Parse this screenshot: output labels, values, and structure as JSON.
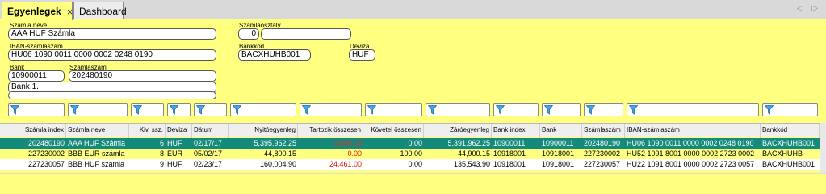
{
  "tabs": [
    {
      "label": "Egyenlegek",
      "close": "×"
    },
    {
      "label": "Dashboard"
    }
  ],
  "nav_arrows": "◁ ▷",
  "form": {
    "szamla_neve": {
      "label": "Számla neve",
      "value": "AAA HUF Számla"
    },
    "szamlaosztaly": {
      "label": "Számlaosztály",
      "value": "0",
      "value2": ""
    },
    "iban": {
      "label": "IBAN-számlaszám",
      "value": "HU06 1090 0011 0000 0002 0248 0190"
    },
    "bankkod": {
      "label": "Bankkód",
      "value": "BACXHUHB001"
    },
    "deviza": {
      "label": "Deviza",
      "value": "HUF"
    },
    "bank": {
      "label": "Bank",
      "value": "10900011"
    },
    "szamlaszam": {
      "label": "Számlaszám",
      "value": "202480190"
    },
    "bank_nev": {
      "value": "Bank 1."
    },
    "extra": {
      "value": ""
    }
  },
  "columns": [
    "Számla index",
    "Számla neve",
    "Kiv. ssz.",
    "Deviza",
    "Dátum",
    "Nyitóegyenleg",
    "Tartozik összesen",
    "Követel összesen",
    "Záróegyenleg",
    "Bank index",
    "Bank",
    "Számlaszám",
    "IBAN-számlaszám",
    "Bankkód"
  ],
  "rows": [
    [
      "202480190",
      "AAA HUF Számla",
      "6",
      "HUF",
      "02/17/17",
      "5,395,962.25",
      "4,000.00",
      "0.00",
      "5,391,962.25",
      "10900011",
      "10900011",
      "202480190",
      "HU06 1090 0011 0000 0002 0248 0190",
      "BACXHUHB001"
    ],
    [
      "227230002",
      "BBB EUR számla",
      "8",
      "EUR",
      "05/02/17",
      "44,800.15",
      "0.00",
      "100.00",
      "44,900.15",
      "10918001",
      "10918001",
      "227230002",
      "HU52 1091 8001 0000 0002 2723 0002",
      "BACXHUHB"
    ],
    [
      "227230057",
      "BBB HUF számla",
      "9",
      "HUF",
      "02/23/17",
      "160,004.90",
      "24,461.00",
      "0.00",
      "135,543.90",
      "10918001",
      "10918001",
      "227230057",
      "HU22 1091 8001 0000 0002 2723 0057",
      "BACXHUHB001"
    ]
  ],
  "colors": {
    "accent": "#138a7a",
    "background": "#ffff80",
    "negative": "#e01010"
  },
  "icons": {
    "filter": "filter-icon",
    "close": "close-icon"
  }
}
